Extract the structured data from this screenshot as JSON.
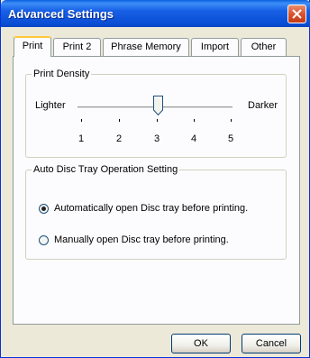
{
  "window": {
    "title": "Advanced Settings"
  },
  "tabs": [
    {
      "label": "Print",
      "active": true
    },
    {
      "label": "Print 2",
      "active": false
    },
    {
      "label": "Phrase Memory",
      "active": false
    },
    {
      "label": "Import",
      "active": false
    },
    {
      "label": "Other",
      "active": false
    }
  ],
  "print_density": {
    "group_label": "Print Density",
    "min_label": "Lighter",
    "max_label": "Darker",
    "ticks": [
      "1",
      "2",
      "3",
      "4",
      "5"
    ],
    "value": 3
  },
  "disc_tray": {
    "group_label": "Auto Disc Tray Operation Setting",
    "options": [
      {
        "label": "Automatically open Disc tray before printing.",
        "selected": true
      },
      {
        "label": "Manually open Disc tray before printing.",
        "selected": false
      }
    ]
  },
  "buttons": {
    "ok": "OK",
    "cancel": "Cancel"
  },
  "icons": {
    "close": "close-icon"
  }
}
